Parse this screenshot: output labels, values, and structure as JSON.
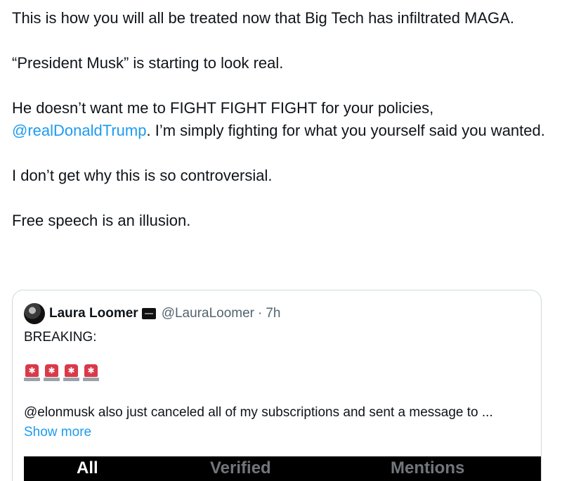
{
  "tweet": {
    "p1": "This is how you will all be treated now that Big Tech has infiltrated MAGA.",
    "p2": "“President Musk” is starting to look real.",
    "p3_before": "He doesn’t want me to FIGHT FIGHT FIGHT for your policies, ",
    "p3_mention": "@realDonaldTrump",
    "p3_after": ". I’m simply fighting for what you yourself said you wanted.",
    "p4": "I don’t get why this is so controversial.",
    "p5": "Free speech is an illusion."
  },
  "quote": {
    "name": "Laura Loomer",
    "handle": "@LauraLoomer",
    "dot": "·",
    "time": "7h",
    "line1": "BREAKING:",
    "sirens": [
      "police-siren-icon",
      "police-siren-icon",
      "police-siren-icon",
      "police-siren-icon"
    ],
    "siren_glyph": "✱",
    "line2": "@elonmusk also just canceled all of my subscriptions and sent a message to ...",
    "show_more": "Show more",
    "tabs": {
      "all": "All",
      "verified": "Verified",
      "mentions": "Mentions"
    }
  },
  "colors": {
    "link": "#1d9bf0",
    "text": "#0f1419",
    "muted": "#536471",
    "siren": "#d93a4a"
  }
}
